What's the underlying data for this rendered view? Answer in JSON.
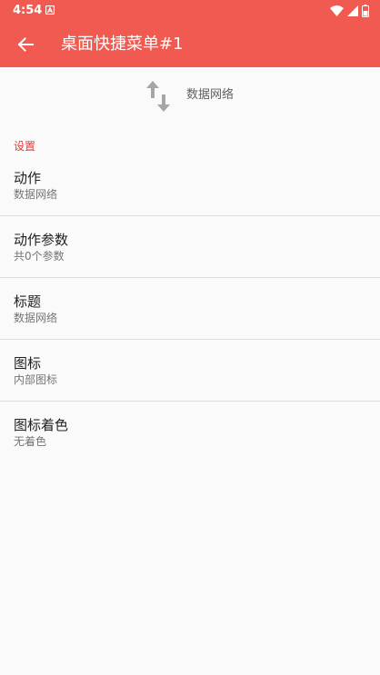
{
  "status_bar": {
    "time": "4:54",
    "icons": [
      "notification-a-icon",
      "wifi-icon",
      "signal-icon",
      "battery-icon"
    ]
  },
  "toolbar": {
    "back_icon": "arrow-back-icon",
    "title": "桌面快捷菜单#1"
  },
  "preview": {
    "icon": "data-network-arrows-icon",
    "label": "数据网络"
  },
  "section": {
    "header": "设置"
  },
  "settings": [
    {
      "title": "动作",
      "summary": "数据网络"
    },
    {
      "title": "动作参数",
      "summary": "共0个参数"
    },
    {
      "title": "标题",
      "summary": "数据网络"
    },
    {
      "title": "图标",
      "summary": "内部图标"
    },
    {
      "title": "图标着色",
      "summary": "无着色"
    }
  ],
  "colors": {
    "app_bar": "#f05a50",
    "accent": "#e53935",
    "background": "#fafafa",
    "divider": "#dcdcdc"
  }
}
